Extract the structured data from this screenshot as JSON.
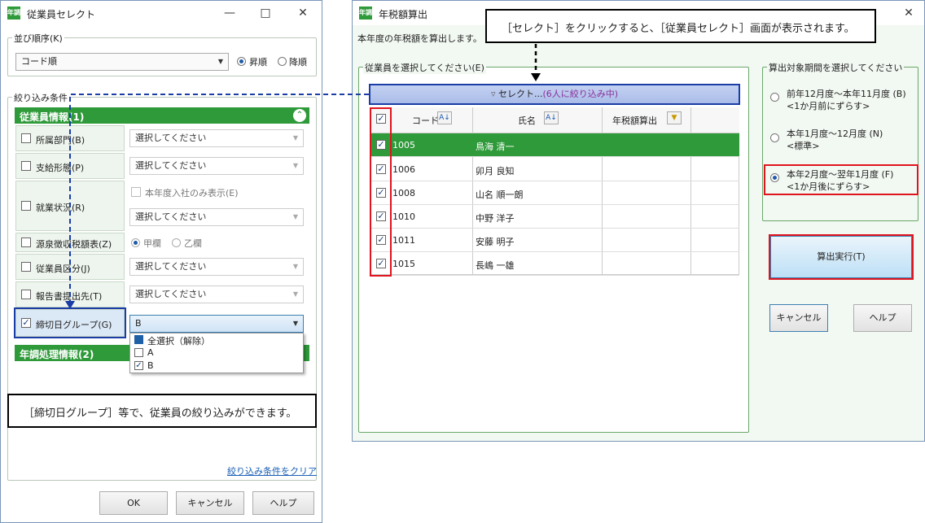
{
  "left_window": {
    "title": "従業員セレクト",
    "sort_group": "並び順序(K)",
    "sort_value": "コード順",
    "asc": "昇順",
    "desc": "降順",
    "filter_group": "絞り込み条件",
    "emp_info_header": "従業員情報(1)",
    "rows": [
      {
        "label": "所属部門(B)",
        "value": "選択してください"
      },
      {
        "label": "支給形態(P)",
        "value": "選択してください"
      },
      {
        "label": "就業状況(R)",
        "sub_check": "本年度入社のみ表示(E)",
        "value": "選択してください"
      },
      {
        "label": "源泉徴収税額表(Z)",
        "radio1": "甲欄",
        "radio2": "乙欄"
      },
      {
        "label": "従業員区分(J)",
        "value": "選択してください"
      },
      {
        "label": "報告書提出先(T)",
        "value": "選択してください"
      },
      {
        "label": "締切日グループ(G)",
        "value": "B"
      }
    ],
    "dropdown_items": [
      "全選択（解除）",
      "A",
      "B"
    ],
    "adj_header": "年調処理情報(2)",
    "clear_link": "絞り込み条件をクリア",
    "ok": "OK",
    "cancel": "キャンセル",
    "help": "ヘルプ"
  },
  "right_window": {
    "title": "年税額算出",
    "description": "本年度の年税額を算出します。",
    "emp_group": "従業員を選択してください(E)",
    "select_button": "セレクト...",
    "select_note": "(6人に絞り込み中)",
    "col_code": "コード",
    "col_name": "氏名",
    "col_tax": "年税額算出",
    "employees": [
      {
        "code": "1005",
        "name": "鳥海 清一"
      },
      {
        "code": "1006",
        "name": "卯月 良知"
      },
      {
        "code": "1008",
        "name": "山名 順一朗"
      },
      {
        "code": "1010",
        "name": "中野 洋子"
      },
      {
        "code": "1011",
        "name": "安藤 明子"
      },
      {
        "code": "1015",
        "name": "長嶋 一雄"
      }
    ],
    "period_group": "算出対象期間を選択してください",
    "periods": [
      {
        "line1": "前年12月度～本年11月度 (B)",
        "line2": "<1か月前にずらす>"
      },
      {
        "line1": "本年1月度～12月度 (N)",
        "line2": "<標準>"
      },
      {
        "line1": "本年2月度～翌年1月度 (F)",
        "line2": "<1か月後にずらす>"
      }
    ],
    "run": "算出実行(T)",
    "cancel": "キャンセル",
    "help": "ヘルプ"
  },
  "callout_top": "［セレクト］をクリックすると、［従業員セレクト］画面が表示されます。",
  "callout_bottom": "［締切日グループ］等で、従業員の絞り込みができます。",
  "app_icon_text": "年調",
  "colors": {
    "green": "#2f9a3a",
    "red": "#e0141e",
    "blue": "#1a3da6"
  }
}
